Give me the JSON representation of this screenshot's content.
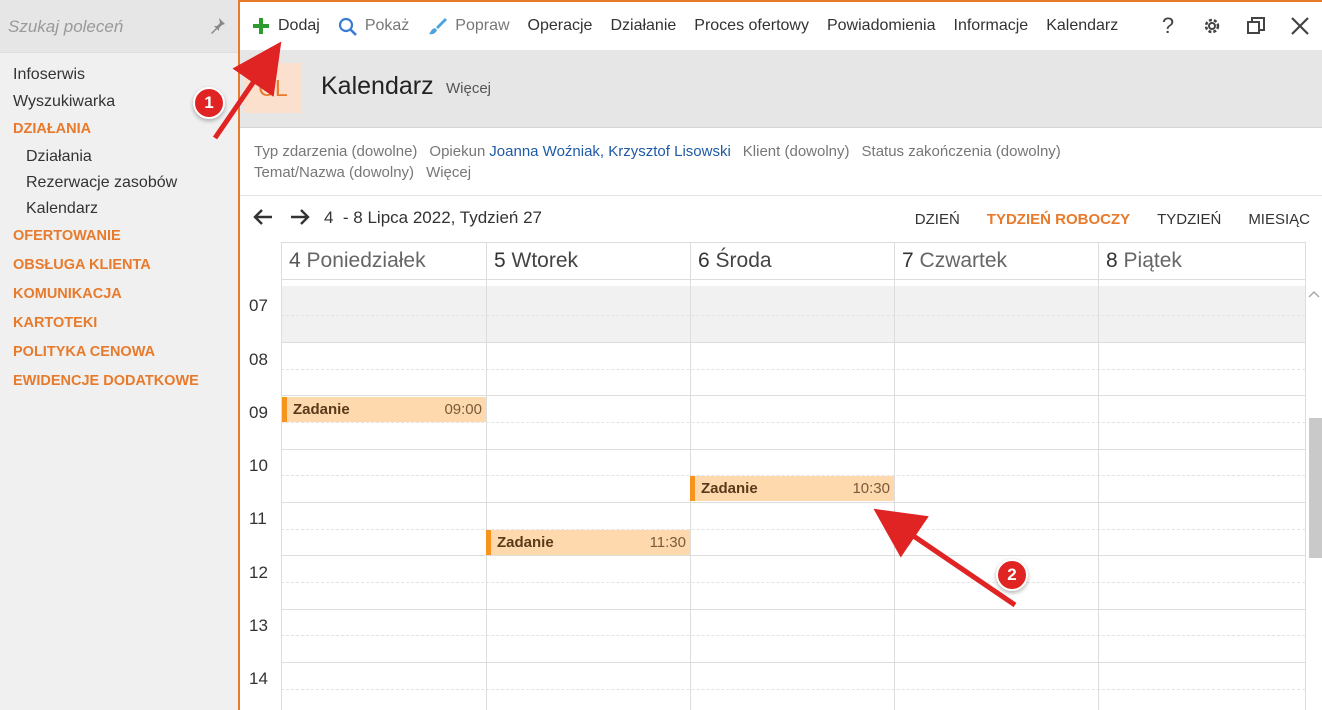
{
  "sidebar": {
    "search_placeholder": "Szukaj poleceń",
    "items": [
      {
        "label": "Infoserwis",
        "type": "item"
      },
      {
        "label": "Wyszukiwarka",
        "type": "item"
      },
      {
        "label": "DZIAŁANIA",
        "type": "category"
      },
      {
        "label": "Działania",
        "type": "sub"
      },
      {
        "label": "Rezerwacje zasobów",
        "type": "sub"
      },
      {
        "label": "Kalendarz",
        "type": "sub"
      },
      {
        "label": "OFERTOWANIE",
        "type": "category"
      },
      {
        "label": "OBSŁUGA KLIENTA",
        "type": "category"
      },
      {
        "label": "KOMUNIKACJA",
        "type": "category"
      },
      {
        "label": "KARTOTEKI",
        "type": "category"
      },
      {
        "label": "POLITYKA CENOWA",
        "type": "category"
      },
      {
        "label": "EWIDENCJE DODATKOWE",
        "type": "category"
      }
    ]
  },
  "toolbar": {
    "add": "Dodaj",
    "show": "Pokaż",
    "edit": "Popraw",
    "operations": "Operacje",
    "action": "Działanie",
    "offer_process": "Proces ofertowy",
    "notifications": "Powiadomienia",
    "info": "Informacje",
    "calendar": "Kalendarz"
  },
  "header": {
    "badge": "CL",
    "title": "Kalendarz",
    "more": "Więcej"
  },
  "filters": {
    "event_type": "Typ zdarzenia (dowolne)",
    "guardian_label": "Opiekun",
    "guardian_value": "Joanna Woźniak, Krzysztof Lisowski",
    "client": "Klient (dowolny)",
    "status": "Status zakończenia (dowolny)",
    "subject": "Temat/Nazwa (dowolny)",
    "more": "Więcej"
  },
  "datebar": {
    "range": "4  - 8 Lipca 2022, Tydzień 27",
    "views": [
      "DZIEŃ",
      "TYDZIEŃ ROBOCZY",
      "TYDZIEŃ",
      "MIESIĄC"
    ],
    "active_view": "TYDZIEŃ ROBOCZY"
  },
  "calendar": {
    "days": [
      {
        "num": "4",
        "name": "Poniedziałek"
      },
      {
        "num": "5",
        "name": "Wtorek"
      },
      {
        "num": "6",
        "name": "Środa"
      },
      {
        "num": "7",
        "name": "Czwartek"
      },
      {
        "num": "8",
        "name": "Piątek"
      }
    ],
    "hours": [
      "07",
      "08",
      "09",
      "10",
      "11",
      "12",
      "13",
      "14"
    ],
    "events": [
      {
        "title": "Zadanie",
        "time": "09:00",
        "day": 0
      },
      {
        "title": "Zadanie",
        "time": "10:30",
        "day": 2
      },
      {
        "title": "Zadanie",
        "time": "11:30",
        "day": 1
      }
    ]
  },
  "callouts": [
    "1",
    "2"
  ],
  "colors": {
    "accent": "#e87a2c",
    "event_bg": "#fdd9ad",
    "event_bar": "#f7941d",
    "marker": "#e02424",
    "link": "#1f5aa6"
  }
}
